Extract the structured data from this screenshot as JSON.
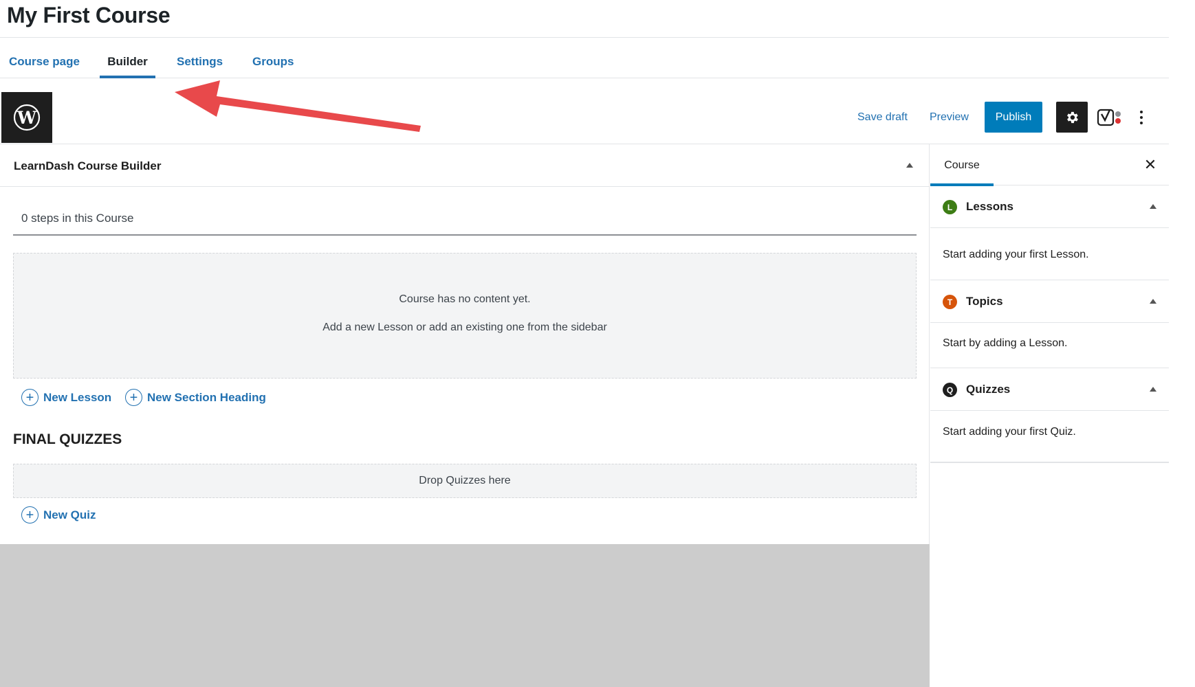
{
  "page": {
    "title": "My First Course"
  },
  "tabs": [
    {
      "label": "Course page"
    },
    {
      "label": "Builder",
      "active": true
    },
    {
      "label": "Settings"
    },
    {
      "label": "Groups"
    }
  ],
  "toolbar": {
    "save_draft": "Save draft",
    "preview": "Preview",
    "publish": "Publish",
    "logo_icon": "wordpress-logo-icon",
    "settings_icon": "gear-icon",
    "seo_icon": "yoast-icon",
    "more_icon": "more-vertical-icon"
  },
  "builder": {
    "title": "LearnDash Course Builder",
    "steps": "0 steps in this Course",
    "empty_line1": "Course has no content yet.",
    "empty_line2": "Add a new Lesson or add an existing one from the sidebar",
    "new_lesson": "New Lesson",
    "new_section": "New Section Heading",
    "final_quizzes": "FINAL QUIZZES",
    "quiz_drop": "Drop Quizzes here",
    "new_quiz": "New Quiz"
  },
  "sidebar": {
    "tab": "Course",
    "panels": [
      {
        "badge": "L",
        "title": "Lessons",
        "text": "Start adding your first Lesson.",
        "color": "#3d7d15"
      },
      {
        "badge": "T",
        "title": "Topics",
        "text": "Start by adding a Lesson.",
        "color": "#d6540a"
      },
      {
        "badge": "Q",
        "title": "Quizzes",
        "text": "Start adding your first Quiz.",
        "color": "#1e1e1e"
      }
    ]
  },
  "colors": {
    "accent": "#007cba",
    "link": "#2271b1",
    "annotation_arrow": "#e8494b"
  }
}
